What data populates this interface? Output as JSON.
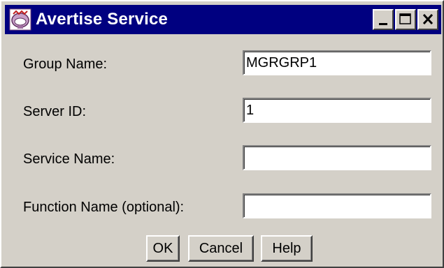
{
  "window": {
    "title": "Avertise Service",
    "titlebar_color": "#000080",
    "face_color": "#d4d0c8",
    "controls": [
      "minimize-icon",
      "maximize-icon",
      "close-icon"
    ]
  },
  "form": {
    "group_name": {
      "label": "Group Name:",
      "value": "MGRGRP1"
    },
    "server_id": {
      "label": "Server ID:",
      "value": "1"
    },
    "service_name": {
      "label": "Service Name:",
      "value": ""
    },
    "function_name": {
      "label": "Function Name (optional):",
      "value": ""
    }
  },
  "buttons": {
    "ok": "OK",
    "cancel": "Cancel",
    "help": "Help"
  }
}
